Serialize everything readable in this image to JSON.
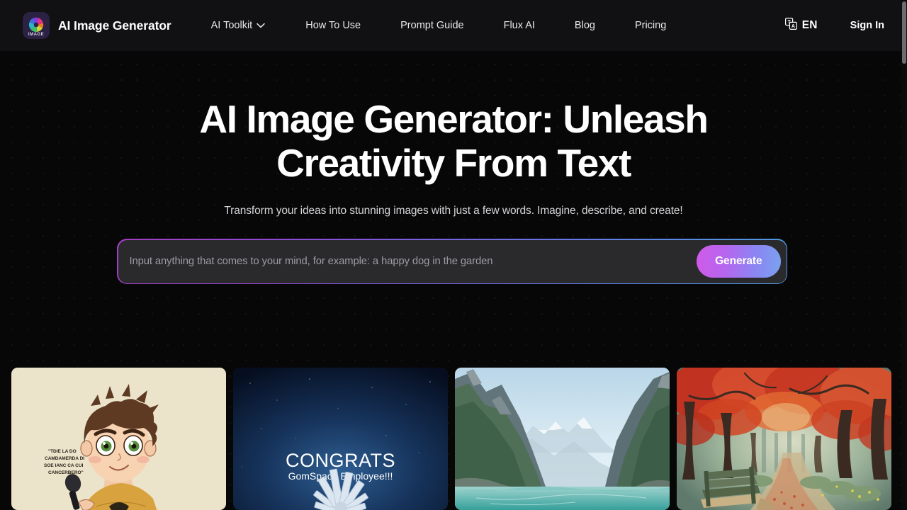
{
  "brand": {
    "name": "AI Image Generator",
    "logo_word": "IMAGE",
    "logo_alt": "ai-image-generator-logo"
  },
  "nav": {
    "items": [
      {
        "label": "AI Toolkit",
        "has_dropdown": true
      },
      {
        "label": "How To Use",
        "has_dropdown": false
      },
      {
        "label": "Prompt Guide",
        "has_dropdown": false
      },
      {
        "label": "Flux AI",
        "has_dropdown": false
      },
      {
        "label": "Blog",
        "has_dropdown": false
      },
      {
        "label": "Pricing",
        "has_dropdown": false
      }
    ],
    "language": "EN",
    "sign_in": "Sign In",
    "chevron": "⌄"
  },
  "hero": {
    "title": "AI Image Generator: Unleash Creativity From Text",
    "subtitle": "Transform your ideas into stunning images with just a few words. Imagine, describe, and create!"
  },
  "prompt": {
    "value": "",
    "placeholder": "Input anything that comes to your mind, for example: a happy dog in the garden",
    "generate_label": "Generate"
  },
  "gallery": {
    "items": [
      {
        "name": "cartoon-boy-with-microphone",
        "caption": "",
        "overlay_text": "“TDIE LA DO CAMDAMERDA DI SOE IANC CA CUI CANCERBERO”"
      },
      {
        "name": "congrats-space-satellites",
        "overlay_title": "CONGRATS",
        "overlay_subtitle": "GomSpace Employee!!!"
      },
      {
        "name": "mountain-fjord-lake",
        "caption": ""
      },
      {
        "name": "autumn-park-bench",
        "caption": ""
      }
    ]
  },
  "colors": {
    "page_bg": "#070707",
    "nav_bg": "#111114",
    "accent_magenta": "#d05ae8",
    "accent_blue": "#7ba2ef",
    "input_bg": "#2a2a2c",
    "text_primary": "#ffffff",
    "text_muted": "#9c9ca3"
  }
}
